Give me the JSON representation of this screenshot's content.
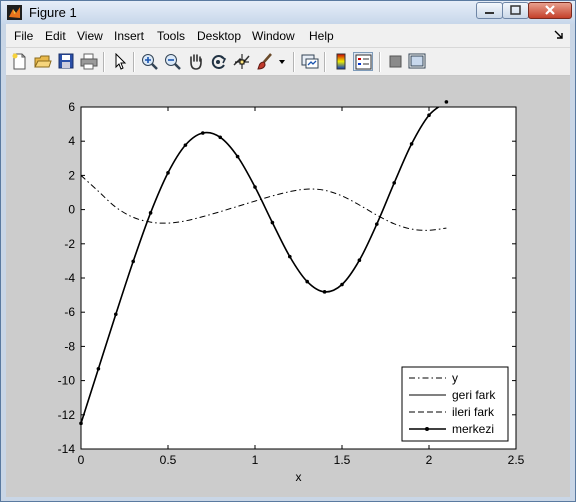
{
  "window": {
    "title": "Figure 1"
  },
  "titlebar": {
    "icon": "matlab-logo-icon",
    "buttons": [
      "minimize-icon",
      "maximize-icon",
      "close-icon"
    ]
  },
  "menubar": {
    "items": [
      "File",
      "Edit",
      "View",
      "Insert",
      "Tools",
      "Desktop",
      "Window",
      "Help"
    ]
  },
  "toolbar": {
    "buttons": [
      {
        "name": "new-figure",
        "icon": "new-document-icon"
      },
      {
        "name": "open-file",
        "icon": "open-folder-icon"
      },
      {
        "name": "save-figure",
        "icon": "floppy-disk-icon"
      },
      {
        "name": "print-figure",
        "icon": "printer-icon"
      },
      {
        "name": "edit-plot",
        "icon": "pointer-arrow-icon"
      },
      {
        "name": "zoom-in",
        "icon": "zoom-in-icon"
      },
      {
        "name": "zoom-out",
        "icon": "zoom-out-icon"
      },
      {
        "name": "pan",
        "icon": "hand-pan-icon"
      },
      {
        "name": "rotate-3d",
        "icon": "rotate-3d-icon"
      },
      {
        "name": "data-cursor",
        "icon": "data-cursor-icon"
      },
      {
        "name": "brush",
        "icon": "brush-icon"
      },
      {
        "name": "link-plot",
        "icon": "link-plot-icon"
      },
      {
        "name": "colorbar",
        "icon": "colorbar-icon"
      },
      {
        "name": "legend",
        "icon": "legend-icon"
      },
      {
        "name": "hide-plot-tools",
        "icon": "hide-plot-tools-icon"
      },
      {
        "name": "show-plot-tools",
        "icon": "show-plot-tools-icon"
      }
    ]
  },
  "colors": {
    "figure_background": "#cccccc",
    "axes_background": "#ffffff",
    "line_color": "#000000"
  },
  "chart_data": {
    "type": "line",
    "title": "",
    "xlabel": "x",
    "ylabel": "",
    "xlim": [
      0,
      2.5
    ],
    "ylim": [
      -14,
      6
    ],
    "xticks": [
      0,
      0.5,
      1,
      1.5,
      2,
      2.5
    ],
    "yticks": [
      6,
      4,
      2,
      0,
      -2,
      -4,
      -6,
      -8,
      -10,
      -12,
      -14
    ],
    "grid": false,
    "legend": {
      "position": "bottom-right",
      "entries": [
        "y",
        "geri fark",
        "ileri fark",
        "merkezi"
      ]
    },
    "series": [
      {
        "name": "y",
        "line_style": "dash-dot",
        "x": [
          0,
          0.1,
          0.2,
          0.3,
          0.4,
          0.5,
          0.6,
          0.7,
          0.8,
          0.9,
          1.0,
          1.1,
          1.2,
          1.3,
          1.4,
          1.5,
          1.6,
          1.7,
          1.8,
          1.9,
          2.0,
          2.1
        ],
        "values": [
          2.0,
          1.07,
          0.14,
          -0.45,
          -0.73,
          -0.79,
          -0.66,
          -0.41,
          -0.12,
          0.19,
          0.5,
          0.8,
          1.05,
          1.2,
          1.13,
          0.8,
          0.27,
          -0.32,
          -0.83,
          -1.14,
          -1.21,
          -1.08
        ]
      },
      {
        "name": "geri fark",
        "line_style": "solid",
        "x": [
          0,
          0.1,
          0.2,
          0.3,
          0.4,
          0.5,
          0.6,
          0.7,
          0.8,
          0.9,
          1.0,
          1.1,
          1.2,
          1.3,
          1.4,
          1.5,
          1.6,
          1.7,
          1.8,
          1.9,
          2.0,
          2.1
        ],
        "values": [
          -12.5,
          -9.31,
          -6.12,
          -3.03,
          -0.19,
          2.15,
          3.77,
          4.48,
          4.23,
          3.1,
          1.32,
          -0.76,
          -2.75,
          -4.21,
          -4.81,
          -4.38,
          -2.96,
          -0.85,
          1.56,
          3.84,
          5.52,
          6.3
        ]
      },
      {
        "name": "ileri fark",
        "line_style": "dashed",
        "x": [
          0,
          0.1,
          0.2,
          0.3,
          0.4,
          0.5,
          0.6,
          0.7,
          0.8,
          0.9,
          1.0,
          1.1,
          1.2,
          1.3,
          1.4,
          1.5,
          1.6,
          1.7,
          1.8,
          1.9,
          2.0,
          2.1
        ],
        "values": [
          -12.5,
          -9.31,
          -6.12,
          -3.03,
          -0.19,
          2.15,
          3.77,
          4.48,
          4.23,
          3.1,
          1.32,
          -0.76,
          -2.75,
          -4.21,
          -4.81,
          -4.38,
          -2.96,
          -0.85,
          1.56,
          3.84,
          5.52,
          6.3
        ]
      },
      {
        "name": "merkezi",
        "line_style": "solid-with-point-markers",
        "x": [
          0,
          0.1,
          0.2,
          0.3,
          0.4,
          0.5,
          0.6,
          0.7,
          0.8,
          0.9,
          1.0,
          1.1,
          1.2,
          1.3,
          1.4,
          1.5,
          1.6,
          1.7,
          1.8,
          1.9,
          2.0,
          2.1
        ],
        "values": [
          -12.5,
          -9.31,
          -6.12,
          -3.03,
          -0.19,
          2.15,
          3.77,
          4.48,
          4.23,
          3.1,
          1.32,
          -0.76,
          -2.75,
          -4.21,
          -4.81,
          -4.38,
          -2.96,
          -0.85,
          1.56,
          3.84,
          5.52,
          6.3
        ]
      }
    ]
  }
}
